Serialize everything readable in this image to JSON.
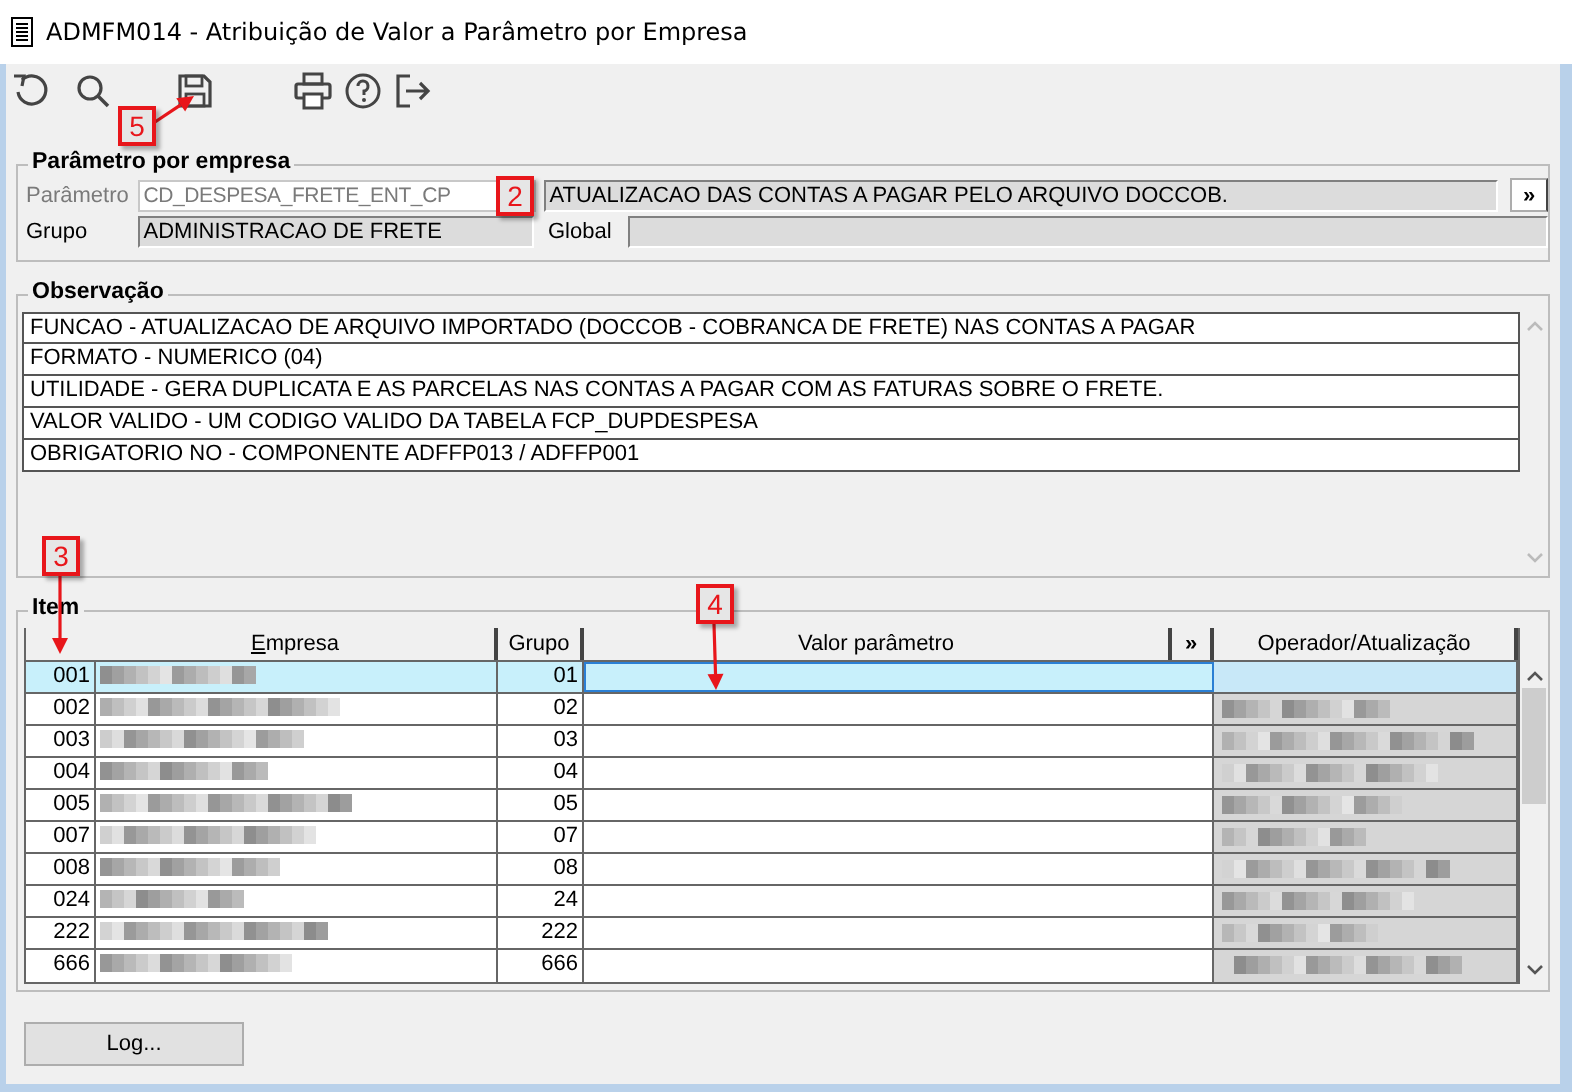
{
  "window": {
    "title": "ADMFM014 - Atribuição de Valor a Parâmetro por Empresa"
  },
  "toolbar": [
    {
      "kind": "undo"
    },
    {
      "kind": "search"
    },
    {
      "kind": "save"
    },
    {
      "kind": "print"
    },
    {
      "kind": "help"
    },
    {
      "kind": "exit"
    }
  ],
  "parametro_group": {
    "title": "Parâmetro por empresa",
    "parametro_label": "Parâmetro",
    "parametro_value": "CD_DESPESA_FRETE_ENT_CP",
    "descricao": "ATUALIZACAO DAS CONTAS A PAGAR PELO ARQUIVO DOCCOB.",
    "expand_button": "»",
    "grupo_label": "Grupo",
    "grupo_value": "ADMINISTRACAO DE FRETE",
    "global_label": "Global"
  },
  "observacao": {
    "title": "Observação",
    "lines": [
      "FUNCAO - ATUALIZACAO DE ARQUIVO IMPORTADO (DOCCOB - COBRANCA DE FRETE) NAS CONTAS A PAGAR",
      "FORMATO - NUMERICO (04)",
      "UTILIDADE - GERA DUPLICATA E AS PARCELAS NAS CONTAS A PAGAR COM AS FATURAS SOBRE O FRETE.",
      "VALOR VALIDO - UM CODIGO VALIDO DA TABELA FCP_DUPDESPESA",
      "OBRIGATORIO NO - COMPONENTE ADFFP013 / ADFFP001"
    ]
  },
  "item": {
    "title": "Item",
    "columns": [
      "Empresa",
      "Grupo",
      "Valor parâmetro",
      "»",
      "Operador/Atualização"
    ],
    "rows": [
      {
        "code": "001",
        "grupo": "01",
        "selected": true,
        "blurred": true
      },
      {
        "code": "002",
        "grupo": "02",
        "selected": false,
        "blurred": true
      },
      {
        "code": "003",
        "grupo": "03",
        "selected": false,
        "blurred": true
      },
      {
        "code": "004",
        "grupo": "04",
        "selected": false,
        "blurred": true
      },
      {
        "code": "005",
        "grupo": "05",
        "selected": false,
        "blurred": true
      },
      {
        "code": "007",
        "grupo": "07",
        "selected": false,
        "blurred": true
      },
      {
        "code": "008",
        "grupo": "08",
        "selected": false,
        "blurred": true
      },
      {
        "code": "024",
        "grupo": "24",
        "selected": false,
        "blurred": true
      },
      {
        "code": "222",
        "grupo": "222",
        "selected": false,
        "blurred": true
      },
      {
        "code": "666",
        "grupo": "666",
        "selected": false,
        "blurred": true
      }
    ]
  },
  "log_button": "Log...",
  "annotations": [
    {
      "label": "5",
      "kind": "arrow-up-right"
    },
    {
      "label": "2",
      "kind": "box"
    },
    {
      "label": "3",
      "kind": "arrow-down"
    },
    {
      "label": "4",
      "kind": "arrow-down"
    }
  ]
}
